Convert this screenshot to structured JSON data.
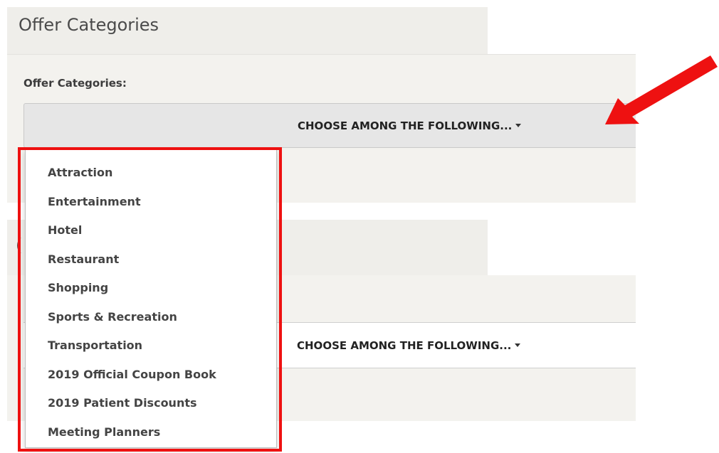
{
  "section1": {
    "tab_title": "Offer Categories",
    "field_label": "Offer Categories:",
    "select_text": "CHOOSE AMONG THE FOLLOWING..."
  },
  "section2": {
    "tab_title_partial": "(",
    "select_text": "CHOOSE AMONG THE FOLLOWING..."
  },
  "dropdown": {
    "items": [
      "Attraction",
      "Entertainment",
      "Hotel",
      "Restaurant",
      "Shopping",
      "Sports & Recreation",
      "Transportation",
      "2019 Official Coupon Book",
      "2019 Patient Discounts",
      "Meeting Planners"
    ]
  },
  "colors": {
    "annotation_red": "#ee1111",
    "panel_bg": "#f3f2ee",
    "tab_bg": "#efeeea",
    "select_bg": "#e6e6e6"
  },
  "icons": {
    "select_caret": "caret-down-icon",
    "annotation_arrow": "arrow-icon"
  }
}
